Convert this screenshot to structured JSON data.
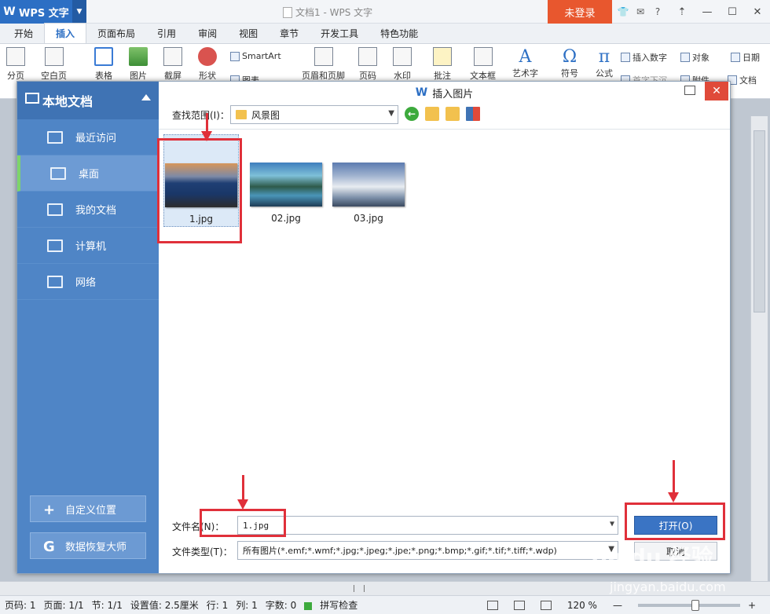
{
  "app": {
    "logo_text": "WPS 文字",
    "doc_title": "文档1 - WPS 文字",
    "login_label": "未登录"
  },
  "menu_tabs": [
    {
      "label": "开始"
    },
    {
      "label": "插入",
      "active": true
    },
    {
      "label": "页面布局"
    },
    {
      "label": "引用"
    },
    {
      "label": "审阅"
    },
    {
      "label": "视图"
    },
    {
      "label": "章节"
    },
    {
      "label": "开发工具"
    },
    {
      "label": "特色功能"
    }
  ],
  "ribbon": {
    "page_break": "分页",
    "blank_page": "空白页",
    "table": "表格",
    "picture": "图片",
    "screenshot": "截屏",
    "shape": "形状",
    "chart": "图表",
    "smartart": "SmartArt",
    "header_footer": "页眉和页脚",
    "page_number": "页码",
    "watermark": "水印",
    "comment": "批注",
    "textbox": "文本框",
    "wordart": "艺术字",
    "symbol": "符号",
    "formula": "公式",
    "insert_number": "插入数字",
    "object": "对象",
    "date": "日期",
    "first_drop": "首字下沉",
    "attachment": "附件",
    "document": "文档"
  },
  "dialog": {
    "title": "插入图片",
    "sidebar_title": "本地文档",
    "sidebar_items": [
      {
        "label": "最近访问"
      },
      {
        "label": "桌面",
        "active": true
      },
      {
        "label": "我的文档"
      },
      {
        "label": "计算机"
      },
      {
        "label": "网络"
      }
    ],
    "custom_location": "自定义位置",
    "data_recovery": "数据恢复大师",
    "lookin_label": "查找范围(I)：",
    "lookin_value": "风景图",
    "files": [
      {
        "name": "1.jpg",
        "selected": true
      },
      {
        "name": "02.jpg"
      },
      {
        "name": "03.jpg"
      }
    ],
    "filename_label": "文件名(N)：",
    "filename_value": "1.jpg",
    "filetype_label": "文件类型(T)：",
    "filetype_value": "所有图片(*.emf;*.wmf;*.jpg;*.jpeg;*.jpe;*.png;*.bmp;*.gif;*.tif;*.tiff;*.wdp)",
    "open_label": "打开(O)",
    "cancel_label": "取消"
  },
  "status": {
    "page_no": "页码: 1",
    "pages": "页面: 1/1",
    "section": "节: 1/1",
    "setting": "设置值: 2.5厘米",
    "row": "行: 1",
    "col": "列: 1",
    "words": "字数: 0",
    "spell": "拼写检查",
    "zoom": "120 %"
  },
  "watermark": {
    "main": "Baidu 经验",
    "url": "jingyan.baidu.com"
  },
  "colors": {
    "brand": "#2c6fc4",
    "login": "#e8572e",
    "sidebar": "#4f85c6",
    "annotation": "#e0303a"
  }
}
